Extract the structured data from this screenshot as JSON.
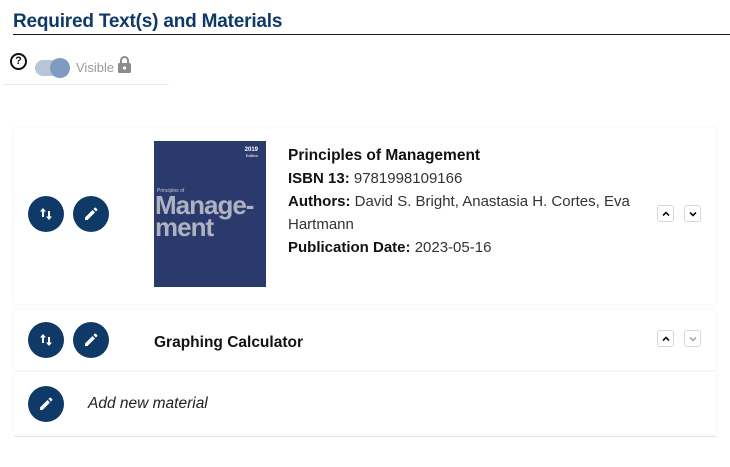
{
  "section": {
    "title": "Required Text(s) and Materials"
  },
  "visibility": {
    "help_icon": "?",
    "label": "Visible",
    "toggle_on": true,
    "locked": true
  },
  "materials": [
    {
      "title": "Principles of Management",
      "isbn_label": "ISBN 13:",
      "isbn": "9781998109166",
      "authors_label": "Authors:",
      "authors": "David S. Bright, Anastasia H. Cortes, Eva Hartmann",
      "pubdate_label": "Publication Date:",
      "pubdate": "2023-05-16",
      "cover": {
        "year": "2019",
        "edition": "Edition",
        "pretitle": "Principles of",
        "title_line1": "Manage-",
        "title_line2": "ment",
        "color": "#2b3a6d"
      }
    },
    {
      "title": "Graphing Calculator"
    }
  ],
  "add_material": {
    "label": "Add new material"
  },
  "icons": {
    "reorder": "swap-vertical-icon",
    "edit": "pencil-icon",
    "up": "chevron-up-icon",
    "down": "chevron-down-icon"
  },
  "colors": {
    "primary": "#0f3a68",
    "toggle_track": "#b7c6d9",
    "toggle_knob": "#7f9cc0"
  }
}
